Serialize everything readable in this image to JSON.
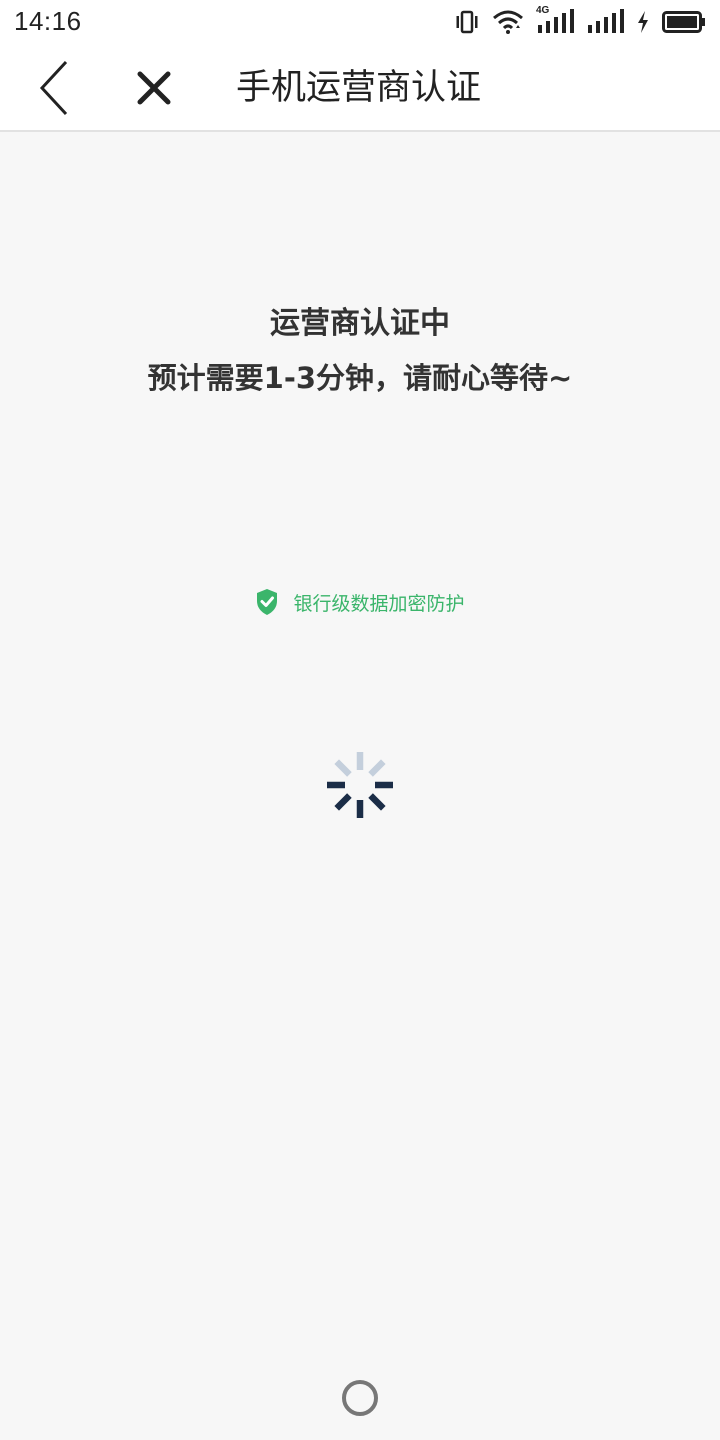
{
  "status_bar": {
    "time": "14:16",
    "icons": [
      "vibrate-icon",
      "wifi-icon",
      "signal-4g-icon",
      "signal-icon",
      "charging-icon",
      "battery-icon"
    ],
    "network_label": "4G"
  },
  "nav": {
    "title": "手机运营商认证",
    "back_icon": "chevron-left-icon",
    "close_icon": "close-icon"
  },
  "main": {
    "status_title": "运营商认证中",
    "status_subtitle": "预计需要1-3分钟，请耐心等待~",
    "security_text": "银行级数据加密防护",
    "security_icon": "shield-check-icon"
  },
  "colors": {
    "accent_green": "#3bb56b",
    "spinner_dark": "#1b2d47",
    "spinner_light": "#c4cfdc"
  }
}
